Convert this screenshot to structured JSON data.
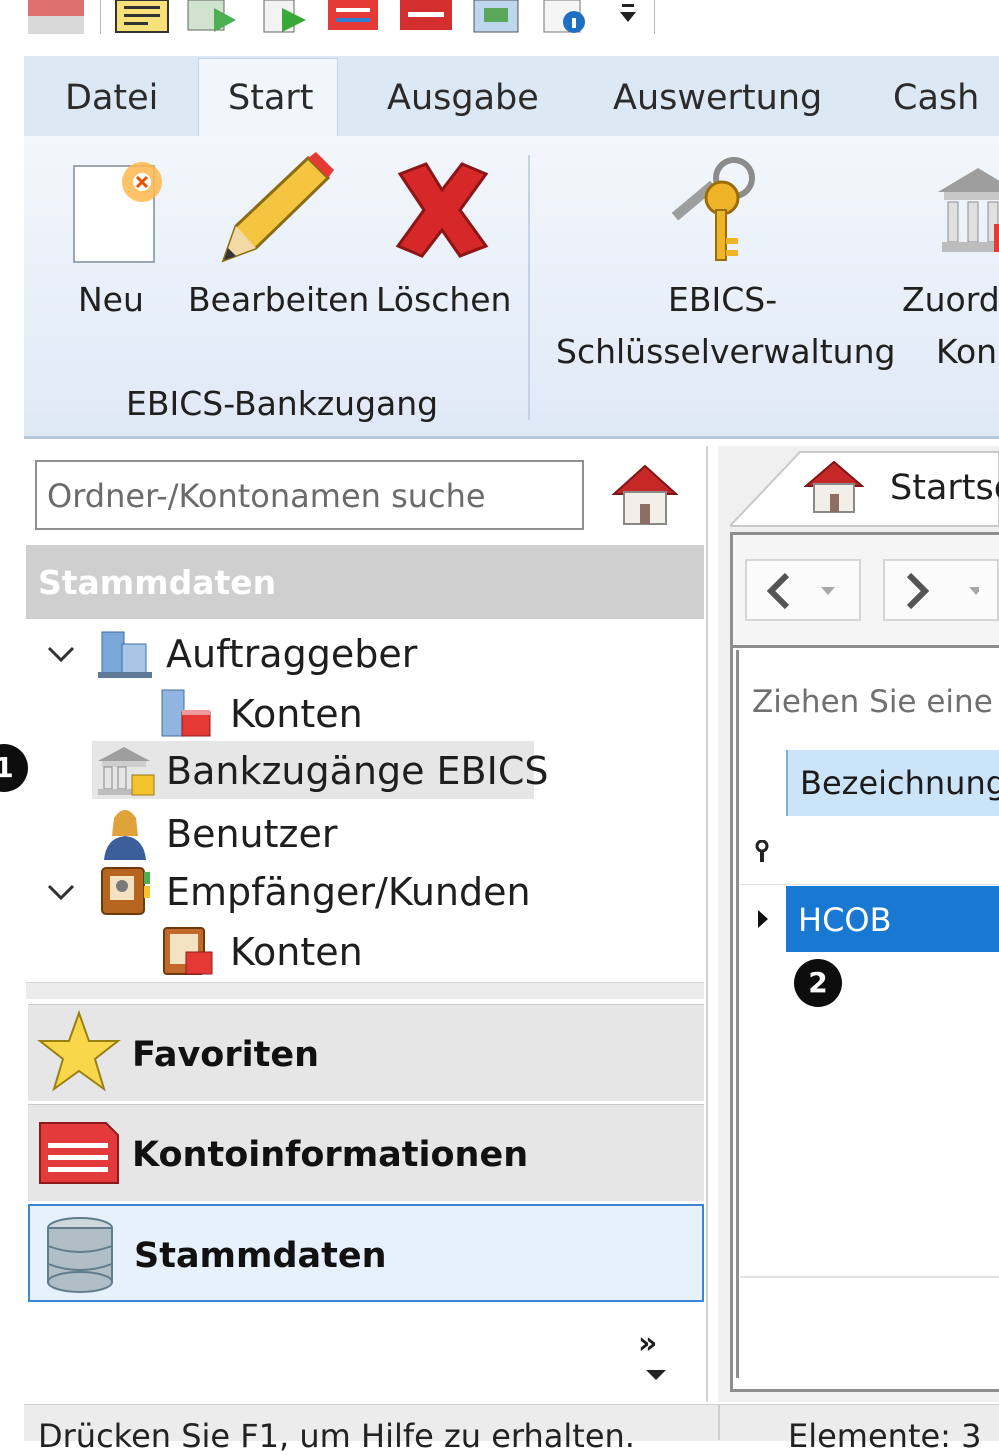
{
  "ribbon": {
    "tabs": [
      "Datei",
      "Start",
      "Ausgabe",
      "Auswertung",
      "Cash"
    ],
    "active_tab": "Start",
    "buttons": {
      "neu": "Neu",
      "bearbeiten": "Bearbeiten",
      "loeschen": "Löschen",
      "ebics_line1": "EBICS-",
      "ebics_line2": "Schlüsselverwaltung",
      "zuord_line1": "Zuord",
      "zuord_line2": "Kon"
    },
    "group_label": "EBICS-Bankzugang"
  },
  "left_panel": {
    "search_placeholder": "Ordner-/Kontonamen suche",
    "section_header": "Stammdaten",
    "tree": [
      {
        "label": "Auftraggeber",
        "icon": "building-icon",
        "expanded": true
      },
      {
        "label": "Konten",
        "icon": "accounts-icon"
      },
      {
        "label": "Bankzugänge EBICS",
        "icon": "bank-icon",
        "selected": true
      },
      {
        "label": "Benutzer",
        "icon": "user-icon"
      },
      {
        "label": "Empfänger/Kunden",
        "icon": "contacts-icon",
        "expanded": true
      },
      {
        "label": "Konten",
        "icon": "accounts-icon"
      }
    ],
    "nav_buttons": [
      {
        "label": "Favoriten",
        "icon": "star-icon"
      },
      {
        "label": "Kontoinformationen",
        "icon": "document-icon"
      },
      {
        "label": "Stammdaten",
        "icon": "database-icon",
        "active": true
      }
    ],
    "overflow": "»"
  },
  "right_panel": {
    "tab_label": "Startse",
    "group_hint": "Ziehen Sie eine",
    "column_header": "Bezeichnung",
    "rows": [
      {
        "label": "HCOB"
      }
    ]
  },
  "badges": {
    "one": "1",
    "two": "2"
  },
  "status": {
    "help": "Drücken Sie F1, um Hilfe zu erhalten.",
    "elements": "Elemente: 3"
  },
  "colors": {
    "ribbon_bg": "#dde8f5",
    "selection_blue": "#1979d2",
    "header_blue": "#cce4f7",
    "active_border": "#3c85d6"
  }
}
